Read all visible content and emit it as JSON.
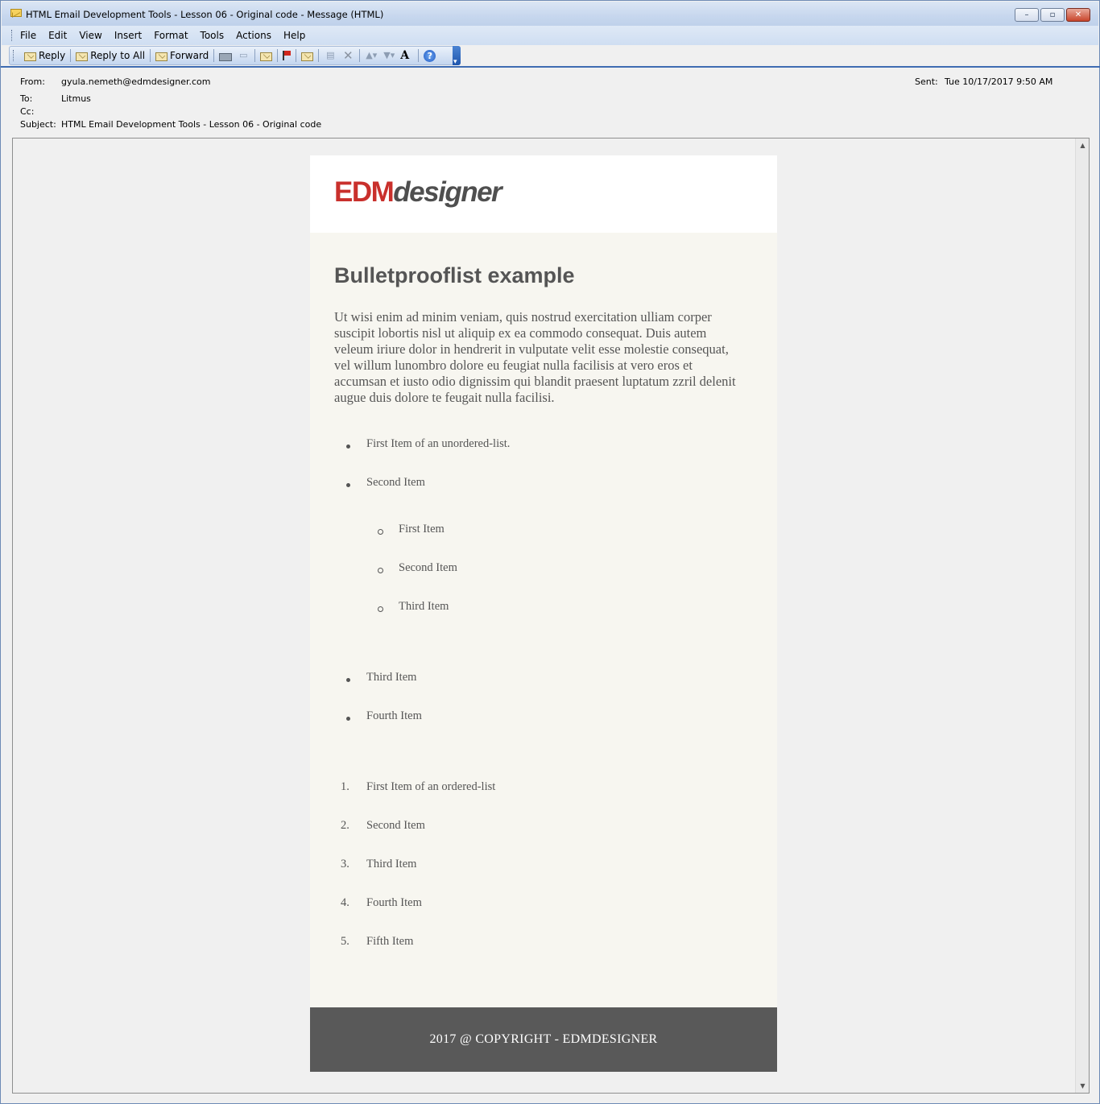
{
  "window": {
    "title": "HTML Email Development Tools - Lesson 06 - Original code - Message (HTML)",
    "controls": {
      "minimize": "–",
      "maximize": "▫",
      "close": "✕"
    }
  },
  "menu": [
    "File",
    "Edit",
    "View",
    "Insert",
    "Format",
    "Tools",
    "Actions",
    "Help"
  ],
  "toolbar": {
    "reply": "Reply",
    "reply_all": "Reply to All",
    "forward": "Forward",
    "font_size": "A",
    "help": "?",
    "icons": [
      "reply-icon",
      "reply-all-icon",
      "forward-icon",
      "print-icon",
      "copy-icon",
      "junk-icon",
      "flag-icon",
      "move-icon",
      "categorize-icon",
      "delete-icon",
      "previous-icon",
      "next-icon",
      "font-size-icon",
      "help-icon"
    ]
  },
  "header": {
    "from_label": "From:",
    "from_value": "gyula.nemeth@edmdesigner.com",
    "to_label": "To:",
    "to_value": "Litmus",
    "cc_label": "Cc:",
    "cc_value": "",
    "subject_label": "Subject:",
    "subject_value": "HTML Email Development Tools - Lesson 06 - Original code",
    "sent_label": "Sent:",
    "sent_value": "Tue 10/17/2017 9:50 AM"
  },
  "email": {
    "logo_edm": "EDM",
    "logo_designer": "designer",
    "heading": "Bulletprooflist example",
    "paragraph": "Ut wisi enim ad minim veniam, quis nostrud exercitation ulliam corper suscipit lobortis nisl ut aliquip ex ea commodo consequat. Duis autem veleum iriure dolor in hendrerit in vulputate velit esse molestie consequat, vel willum lunombro dolore eu feugiat nulla facilisis at vero eros et accumsan et iusto odio dignissim qui blandit praesent luptatum zzril delenit augue duis dolore te feugait nulla facilisi.",
    "unordered": [
      "First Item of an unordered-list.",
      "Second Item"
    ],
    "nested": [
      "First Item",
      "Second Item",
      "Third Item"
    ],
    "unordered_rest": [
      "Third Item",
      "Fourth Item"
    ],
    "ordered": [
      "First Item of an ordered-list",
      "Second Item",
      "Third Item",
      "Fourth Item",
      "Fifth Item"
    ],
    "ordered_numbers": [
      "1.",
      "2.",
      "3.",
      "4.",
      "5."
    ],
    "footer": "2017 @ COPYRIGHT - EDMDESIGNER"
  },
  "colors": {
    "logo_red": "#c9302c",
    "logo_gray": "#4f4f4f",
    "body_bg": "#f7f6f0",
    "footer_bg": "#595959",
    "text": "#555555"
  }
}
